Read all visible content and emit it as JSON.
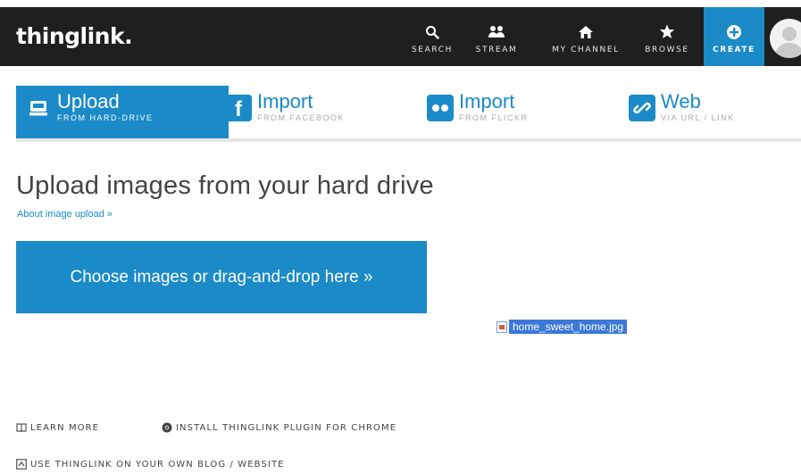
{
  "brand": {
    "logo": "thinglink."
  },
  "nav": {
    "search": "SEARCH",
    "stream": "STREAM",
    "channel": "MY CHANNEL",
    "browse": "BROWSE",
    "create": "CREATE"
  },
  "tabs": [
    {
      "title": "Upload",
      "sub": "FROM HARD-DRIVE",
      "icon": "hard-drive-icon",
      "active": true
    },
    {
      "title": "Import",
      "sub": "FROM FACEBOOK",
      "icon": "facebook-icon",
      "active": false
    },
    {
      "title": "Import",
      "sub": "FROM FLICKR",
      "icon": "flickr-icon",
      "active": false
    },
    {
      "title": "Web",
      "sub": "VIA URL / LINK",
      "icon": "link-icon",
      "active": false
    }
  ],
  "main": {
    "heading": "Upload images from your hard drive",
    "about_link": "About image upload »",
    "choose_button": "Choose images or drag-and-drop here »",
    "dragged_file": "home_sweet_home.jpg"
  },
  "footer": {
    "learn_more": "LEARN MORE",
    "plugin": "INSTALL THINGLINK PLUGIN FOR CHROME",
    "blog": "USE THINGLINK ON YOUR OWN BLOG / WEBSITE"
  },
  "colors": {
    "accent": "#1a8ac8",
    "topbar": "#1f1f1f"
  }
}
